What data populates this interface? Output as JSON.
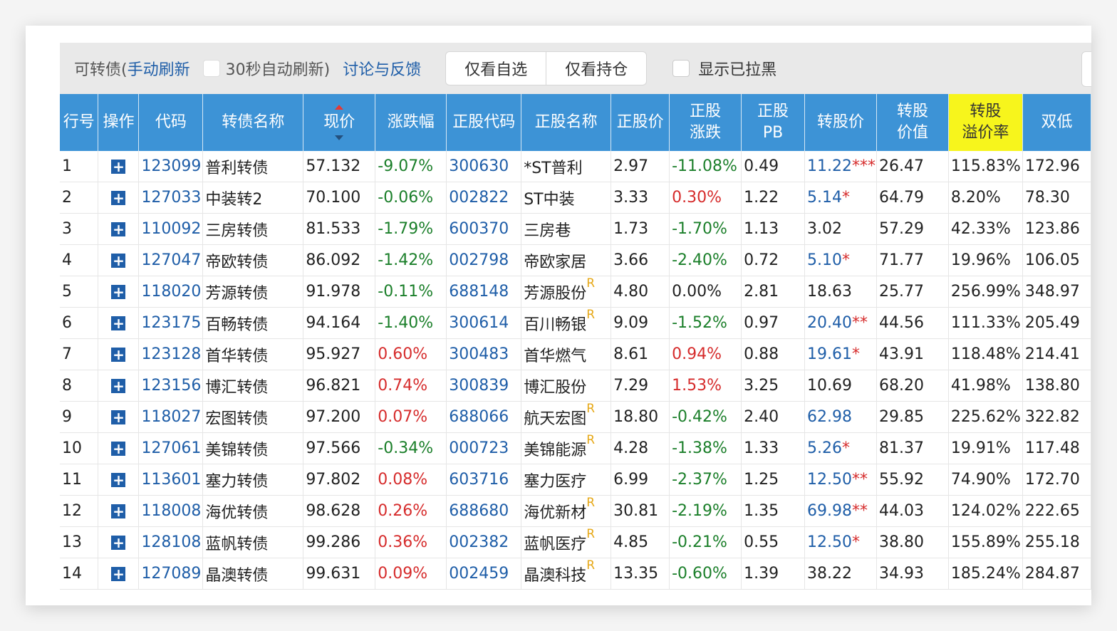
{
  "toolbar": {
    "title": "可转债(",
    "manual_refresh": "手动刷新",
    "auto_refresh": "30秒自动刷新)",
    "feedback": "讨论与反馈",
    "btn_watchlist": "仅看自选",
    "btn_holdings": "仅看持仓",
    "show_blacklisted": "显示已拉黑"
  },
  "columns": [
    "行号",
    "操作",
    "代码",
    "转债名称",
    "现价",
    "涨跌幅",
    "正股代码",
    "正股名称",
    "正股价",
    "正股\n涨跌",
    "正股\nPB",
    "转股价",
    "转股\n价值",
    "转股\n溢价率",
    "双低"
  ],
  "highlight_color": "#f7f51c",
  "header_color": "#3d93d6",
  "rows": [
    {
      "no": "1",
      "code": "123099",
      "name": "普利转债",
      "price": "57.132",
      "chg": "-9.07%",
      "scode": "300630",
      "sname": "*ST普利",
      "sr": "",
      "sprice": "2.97",
      "schg": "-11.08%",
      "pb": "0.49",
      "cprice": "11.22",
      "cstar": "***",
      "cval": "26.47",
      "prem": "115.83%",
      "dual": "172.96"
    },
    {
      "no": "2",
      "code": "127033",
      "name": "中装转2",
      "price": "70.100",
      "chg": "-0.06%",
      "scode": "002822",
      "sname": "ST中装",
      "sr": "",
      "sprice": "3.33",
      "schg": "0.30%",
      "pb": "1.22",
      "cprice": "5.14",
      "cstar": "*",
      "cval": "64.79",
      "prem": "8.20%",
      "dual": "78.30"
    },
    {
      "no": "3",
      "code": "110092",
      "name": "三房转债",
      "price": "81.533",
      "chg": "-1.79%",
      "scode": "600370",
      "sname": "三房巷",
      "sr": "",
      "sprice": "1.73",
      "schg": "-1.70%",
      "pb": "1.13",
      "cprice": "3.02",
      "cstar": "",
      "cval": "57.29",
      "prem": "42.33%",
      "dual": "123.86"
    },
    {
      "no": "4",
      "code": "127047",
      "name": "帝欧转债",
      "price": "86.092",
      "chg": "-1.42%",
      "scode": "002798",
      "sname": "帝欧家居",
      "sr": "",
      "sprice": "3.66",
      "schg": "-2.40%",
      "pb": "0.72",
      "cprice": "5.10",
      "cstar": "*",
      "cval": "71.77",
      "prem": "19.96%",
      "dual": "106.05"
    },
    {
      "no": "5",
      "code": "118020",
      "name": "芳源转债",
      "price": "91.978",
      "chg": "-0.11%",
      "scode": "688148",
      "sname": "芳源股份",
      "sr": "R",
      "sprice": "4.80",
      "schg": "0.00%",
      "pb": "2.81",
      "cprice": "18.63",
      "cstar": "",
      "cval": "25.77",
      "prem": "256.99%",
      "dual": "348.97"
    },
    {
      "no": "6",
      "code": "123175",
      "name": "百畅转债",
      "price": "94.164",
      "chg": "-1.40%",
      "scode": "300614",
      "sname": "百川畅银",
      "sr": "R",
      "sprice": "9.09",
      "schg": "-1.52%",
      "pb": "0.97",
      "cprice": "20.40",
      "cstar": "**",
      "cval": "44.56",
      "prem": "111.33%",
      "dual": "205.49"
    },
    {
      "no": "7",
      "code": "123128",
      "name": "首华转债",
      "price": "95.927",
      "chg": "0.60%",
      "scode": "300483",
      "sname": "首华燃气",
      "sr": "",
      "sprice": "8.61",
      "schg": "0.94%",
      "pb": "0.88",
      "cprice": "19.61",
      "cstar": "*",
      "cval": "43.91",
      "prem": "118.48%",
      "dual": "214.41"
    },
    {
      "no": "8",
      "code": "123156",
      "name": "博汇转债",
      "price": "96.821",
      "chg": "0.74%",
      "scode": "300839",
      "sname": "博汇股份",
      "sr": "",
      "sprice": "7.29",
      "schg": "1.53%",
      "pb": "3.25",
      "cprice": "10.69",
      "cstar": "",
      "cval": "68.20",
      "prem": "41.98%",
      "dual": "138.80"
    },
    {
      "no": "9",
      "code": "118027",
      "name": "宏图转债",
      "price": "97.200",
      "chg": "0.07%",
      "scode": "688066",
      "sname": "航天宏图",
      "sr": "R",
      "sprice": "18.80",
      "schg": "-0.42%",
      "pb": "2.40",
      "cprice": "62.98",
      "cstar": "",
      "cval": "29.85",
      "prem": "225.62%",
      "dual": "322.82"
    },
    {
      "no": "10",
      "code": "127061",
      "name": "美锦转债",
      "price": "97.566",
      "chg": "-0.34%",
      "scode": "000723",
      "sname": "美锦能源",
      "sr": "R",
      "sprice": "4.28",
      "schg": "-1.38%",
      "pb": "1.33",
      "cprice": "5.26",
      "cstar": "*",
      "cval": "81.37",
      "prem": "19.91%",
      "dual": "117.48"
    },
    {
      "no": "11",
      "code": "113601",
      "name": "塞力转债",
      "price": "97.802",
      "chg": "0.08%",
      "scode": "603716",
      "sname": "塞力医疗",
      "sr": "",
      "sprice": "6.99",
      "schg": "-2.37%",
      "pb": "1.25",
      "cprice": "12.50",
      "cstar": "**",
      "cval": "55.92",
      "prem": "74.90%",
      "dual": "172.70"
    },
    {
      "no": "12",
      "code": "118008",
      "name": "海优转债",
      "price": "98.628",
      "chg": "0.26%",
      "scode": "688680",
      "sname": "海优新材",
      "sr": "R",
      "sprice": "30.81",
      "schg": "-2.19%",
      "pb": "1.35",
      "cprice": "69.98",
      "cstar": "**",
      "cval": "44.03",
      "prem": "124.02%",
      "dual": "222.65"
    },
    {
      "no": "13",
      "code": "128108",
      "name": "蓝帆转债",
      "price": "99.286",
      "chg": "0.36%",
      "scode": "002382",
      "sname": "蓝帆医疗",
      "sr": "R",
      "sprice": "4.85",
      "schg": "-0.21%",
      "pb": "0.55",
      "cprice": "12.50",
      "cstar": "*",
      "cval": "38.80",
      "prem": "155.89%",
      "dual": "255.18"
    },
    {
      "no": "14",
      "code": "127089",
      "name": "晶澳转债",
      "price": "99.631",
      "chg": "0.09%",
      "scode": "002459",
      "sname": "晶澳科技",
      "sr": "R",
      "sprice": "13.35",
      "schg": "-0.60%",
      "pb": "1.39",
      "cprice": "38.22",
      "cstar": "",
      "cval": "34.93",
      "prem": "185.24%",
      "dual": "284.87"
    }
  ]
}
